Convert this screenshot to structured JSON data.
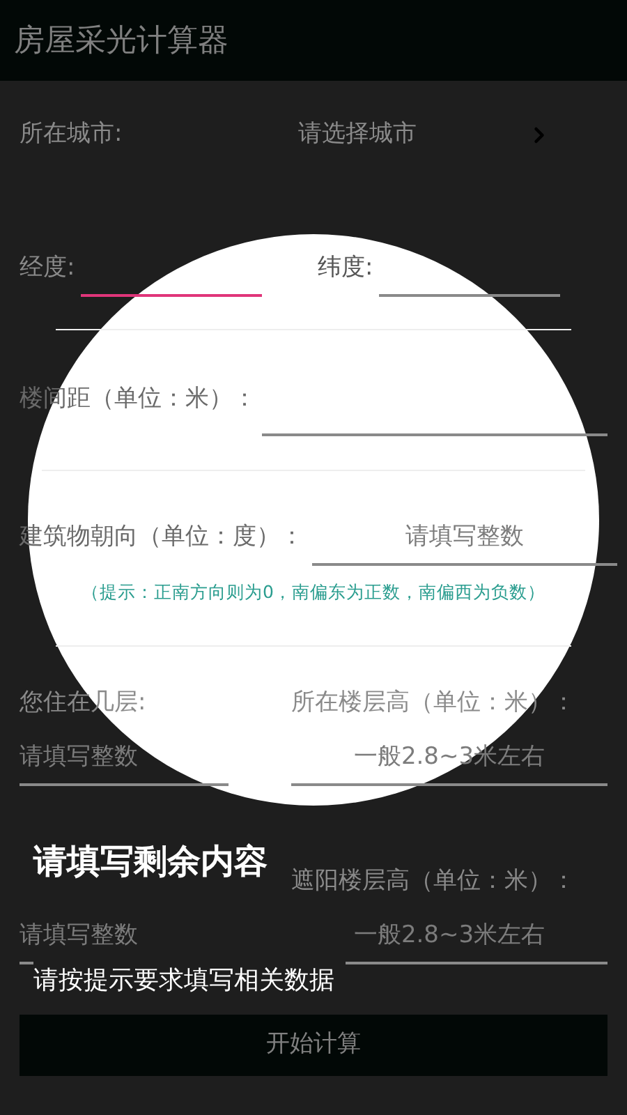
{
  "app_bar": {
    "title": "房屋采光计算器"
  },
  "city_row": {
    "label": "所在城市:",
    "value": "请选择城市"
  },
  "coordinates": [
    {
      "label": "经度:",
      "focused": true
    },
    {
      "label": "纬度:",
      "focused": false
    }
  ],
  "spacing": {
    "label": "楼间距（单位：米）："
  },
  "orientation": {
    "label": "建筑物朝向（单位：度）：",
    "placeholder": "请填写整数",
    "hint": "（提示：正南方向则为0，南偏东为正数，南偏西为负数）"
  },
  "floor_rows": [
    {
      "left": {
        "label": "您住在几层:",
        "placeholder": "请填写整数"
      },
      "right": {
        "label": "所在楼层高（单位：米）：",
        "placeholder": "一般2.8~3米左右"
      }
    },
    {
      "left": {
        "placeholder": "请填写整数"
      },
      "right": {
        "label": "遮阳楼层高（单位：米）：",
        "placeholder": "一般2.8~3米左右"
      }
    }
  ],
  "submit_button": "开始计算",
  "tip": {
    "title": "请填写剩余内容",
    "message": "请按提示要求填写相关数据"
  }
}
